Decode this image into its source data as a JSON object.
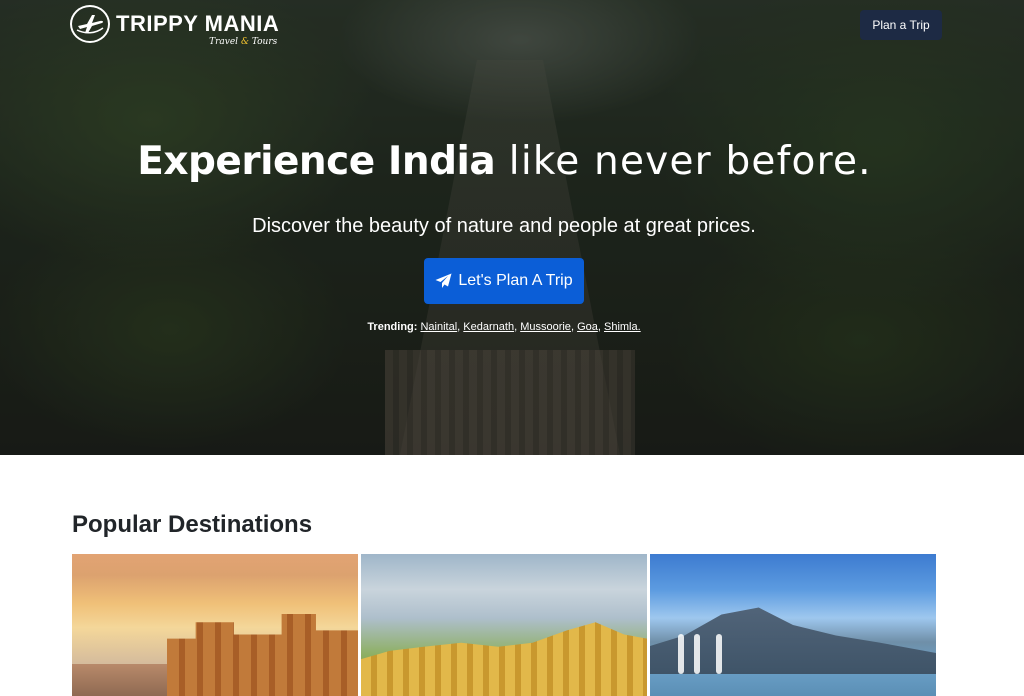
{
  "brand": {
    "name": "TRIPPY MANIA",
    "tagline_part1": "Travel",
    "tagline_amp": "&",
    "tagline_part2": "Tours"
  },
  "nav": {
    "plan_button_label": "Plan a Trip"
  },
  "hero": {
    "title_bold": "Experience India",
    "title_light": "like never before.",
    "subtitle": "Discover the beauty of nature and people at great prices.",
    "cta_label": "Let's Plan A Trip",
    "trending_label": "Trending:",
    "trending_links": [
      "Nainital",
      "Kedarnath",
      "Mussoorie",
      "Goa",
      "Shimla."
    ]
  },
  "destinations": {
    "heading": "Popular Destinations"
  },
  "colors": {
    "cta_blue": "#0b5ed7",
    "nav_button_navy": "#1d2a44",
    "tagline_amp_gold": "#f2c230"
  },
  "icons": {
    "logo": "airplane-globe-icon",
    "cta": "paper-plane-icon"
  }
}
